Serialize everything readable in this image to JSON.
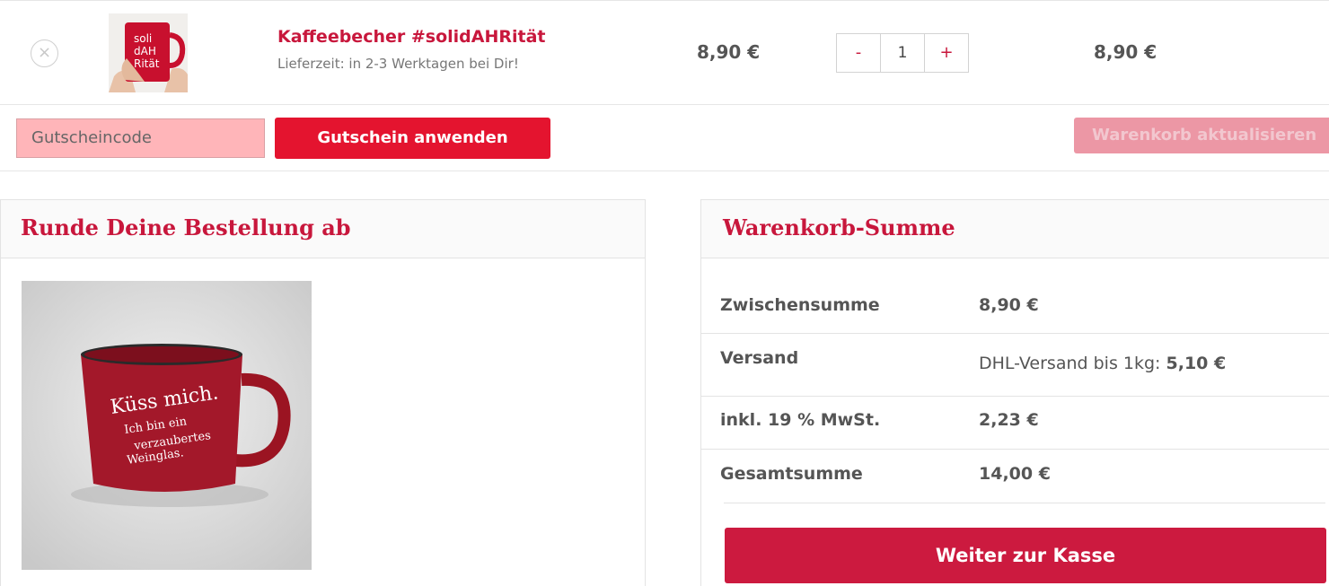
{
  "cart": {
    "remove_symbol": "×",
    "product_name": "Kaffeebecher #solidAHRität",
    "delivery_text": "Lieferzeit: in 2-3 Werktagen bei Dir!",
    "price": "8,90 €",
    "qty_minus": "-",
    "qty_value": "1",
    "qty_plus": "+",
    "subtotal": "8,90 €",
    "thumb_text": [
      "soli",
      "dAH",
      "Rität"
    ]
  },
  "coupon": {
    "placeholder": "Gutscheincode",
    "apply_label": "Gutschein anwenden",
    "update_label": "Warenkorb aktualisieren"
  },
  "cross_sells": {
    "title": "Runde Deine Bestellung ab",
    "mug_text": [
      "Küss mich.",
      "Ich bin ein",
      "verzaubertes",
      "Weinglas."
    ]
  },
  "totals": {
    "title": "Warenkorb-Summe",
    "subtotal_label": "Zwischensumme",
    "subtotal_value": "8,90 €",
    "shipping_label": "Versand",
    "shipping_method": "DHL-Versand bis 1kg:",
    "shipping_price": "5,10 €",
    "tax_label": "inkl. 19 % MwSt.",
    "tax_value": "2,23 €",
    "total_label": "Gesamtsumme",
    "total_value": "14,00 €",
    "checkout_label": "Weiter zur Kasse"
  },
  "colors": {
    "brand": "#c8173c",
    "coupon_button": "#e4142f",
    "coupon_field": "#ffb5b9",
    "update_disabled": "#ec97a5"
  }
}
